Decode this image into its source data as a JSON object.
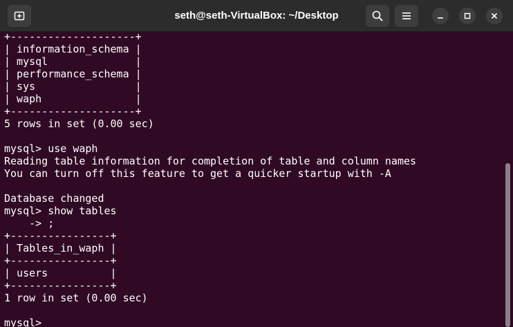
{
  "window": {
    "title": "seth@seth-VirtualBox: ~/Desktop"
  },
  "toolbar": {
    "new_tab_icon": "new-tab-icon",
    "search_icon": "search-icon",
    "menu_icon": "hamburger-menu-icon",
    "minimize_icon": "minimize-icon",
    "maximize_icon": "maximize-icon",
    "close_icon": "close-icon"
  },
  "terminal": {
    "lines": [
      "+--------------------+",
      "| information_schema |",
      "| mysql              |",
      "| performance_schema |",
      "| sys                |",
      "| waph               |",
      "+--------------------+",
      "5 rows in set (0.00 sec)",
      "",
      "mysql> use waph",
      "Reading table information for completion of table and column names",
      "You can turn off this feature to get a quicker startup with -A",
      "",
      "Database changed",
      "mysql> show tables",
      "    -> ;",
      "+----------------+",
      "| Tables_in_waph |",
      "+----------------+",
      "| users          |",
      "+----------------+",
      "1 row in set (0.00 sec)",
      "",
      "mysql>"
    ]
  },
  "colors": {
    "terminal_bg": "#300a24",
    "titlebar_bg": "#2c2c2c",
    "text": "#ffffff"
  }
}
